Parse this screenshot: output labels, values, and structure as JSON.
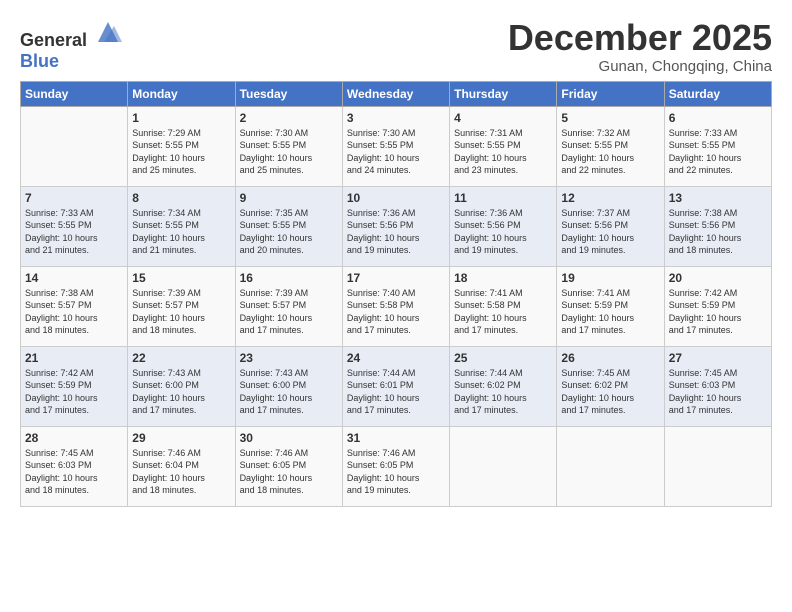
{
  "logo": {
    "general": "General",
    "blue": "Blue"
  },
  "title": "December 2025",
  "subtitle": "Gunan, Chongqing, China",
  "days_header": [
    "Sunday",
    "Monday",
    "Tuesday",
    "Wednesday",
    "Thursday",
    "Friday",
    "Saturday"
  ],
  "weeks": [
    [
      {
        "day": "",
        "info": ""
      },
      {
        "day": "1",
        "info": "Sunrise: 7:29 AM\nSunset: 5:55 PM\nDaylight: 10 hours\nand 25 minutes."
      },
      {
        "day": "2",
        "info": "Sunrise: 7:30 AM\nSunset: 5:55 PM\nDaylight: 10 hours\nand 25 minutes."
      },
      {
        "day": "3",
        "info": "Sunrise: 7:30 AM\nSunset: 5:55 PM\nDaylight: 10 hours\nand 24 minutes."
      },
      {
        "day": "4",
        "info": "Sunrise: 7:31 AM\nSunset: 5:55 PM\nDaylight: 10 hours\nand 23 minutes."
      },
      {
        "day": "5",
        "info": "Sunrise: 7:32 AM\nSunset: 5:55 PM\nDaylight: 10 hours\nand 22 minutes."
      },
      {
        "day": "6",
        "info": "Sunrise: 7:33 AM\nSunset: 5:55 PM\nDaylight: 10 hours\nand 22 minutes."
      }
    ],
    [
      {
        "day": "7",
        "info": "Sunrise: 7:33 AM\nSunset: 5:55 PM\nDaylight: 10 hours\nand 21 minutes."
      },
      {
        "day": "8",
        "info": "Sunrise: 7:34 AM\nSunset: 5:55 PM\nDaylight: 10 hours\nand 21 minutes."
      },
      {
        "day": "9",
        "info": "Sunrise: 7:35 AM\nSunset: 5:55 PM\nDaylight: 10 hours\nand 20 minutes."
      },
      {
        "day": "10",
        "info": "Sunrise: 7:36 AM\nSunset: 5:56 PM\nDaylight: 10 hours\nand 19 minutes."
      },
      {
        "day": "11",
        "info": "Sunrise: 7:36 AM\nSunset: 5:56 PM\nDaylight: 10 hours\nand 19 minutes."
      },
      {
        "day": "12",
        "info": "Sunrise: 7:37 AM\nSunset: 5:56 PM\nDaylight: 10 hours\nand 19 minutes."
      },
      {
        "day": "13",
        "info": "Sunrise: 7:38 AM\nSunset: 5:56 PM\nDaylight: 10 hours\nand 18 minutes."
      }
    ],
    [
      {
        "day": "14",
        "info": "Sunrise: 7:38 AM\nSunset: 5:57 PM\nDaylight: 10 hours\nand 18 minutes."
      },
      {
        "day": "15",
        "info": "Sunrise: 7:39 AM\nSunset: 5:57 PM\nDaylight: 10 hours\nand 18 minutes."
      },
      {
        "day": "16",
        "info": "Sunrise: 7:39 AM\nSunset: 5:57 PM\nDaylight: 10 hours\nand 17 minutes."
      },
      {
        "day": "17",
        "info": "Sunrise: 7:40 AM\nSunset: 5:58 PM\nDaylight: 10 hours\nand 17 minutes."
      },
      {
        "day": "18",
        "info": "Sunrise: 7:41 AM\nSunset: 5:58 PM\nDaylight: 10 hours\nand 17 minutes."
      },
      {
        "day": "19",
        "info": "Sunrise: 7:41 AM\nSunset: 5:59 PM\nDaylight: 10 hours\nand 17 minutes."
      },
      {
        "day": "20",
        "info": "Sunrise: 7:42 AM\nSunset: 5:59 PM\nDaylight: 10 hours\nand 17 minutes."
      }
    ],
    [
      {
        "day": "21",
        "info": "Sunrise: 7:42 AM\nSunset: 5:59 PM\nDaylight: 10 hours\nand 17 minutes."
      },
      {
        "day": "22",
        "info": "Sunrise: 7:43 AM\nSunset: 6:00 PM\nDaylight: 10 hours\nand 17 minutes."
      },
      {
        "day": "23",
        "info": "Sunrise: 7:43 AM\nSunset: 6:00 PM\nDaylight: 10 hours\nand 17 minutes."
      },
      {
        "day": "24",
        "info": "Sunrise: 7:44 AM\nSunset: 6:01 PM\nDaylight: 10 hours\nand 17 minutes."
      },
      {
        "day": "25",
        "info": "Sunrise: 7:44 AM\nSunset: 6:02 PM\nDaylight: 10 hours\nand 17 minutes."
      },
      {
        "day": "26",
        "info": "Sunrise: 7:45 AM\nSunset: 6:02 PM\nDaylight: 10 hours\nand 17 minutes."
      },
      {
        "day": "27",
        "info": "Sunrise: 7:45 AM\nSunset: 6:03 PM\nDaylight: 10 hours\nand 17 minutes."
      }
    ],
    [
      {
        "day": "28",
        "info": "Sunrise: 7:45 AM\nSunset: 6:03 PM\nDaylight: 10 hours\nand 18 minutes."
      },
      {
        "day": "29",
        "info": "Sunrise: 7:46 AM\nSunset: 6:04 PM\nDaylight: 10 hours\nand 18 minutes."
      },
      {
        "day": "30",
        "info": "Sunrise: 7:46 AM\nSunset: 6:05 PM\nDaylight: 10 hours\nand 18 minutes."
      },
      {
        "day": "31",
        "info": "Sunrise: 7:46 AM\nSunset: 6:05 PM\nDaylight: 10 hours\nand 19 minutes."
      },
      {
        "day": "",
        "info": ""
      },
      {
        "day": "",
        "info": ""
      },
      {
        "day": "",
        "info": ""
      }
    ]
  ]
}
